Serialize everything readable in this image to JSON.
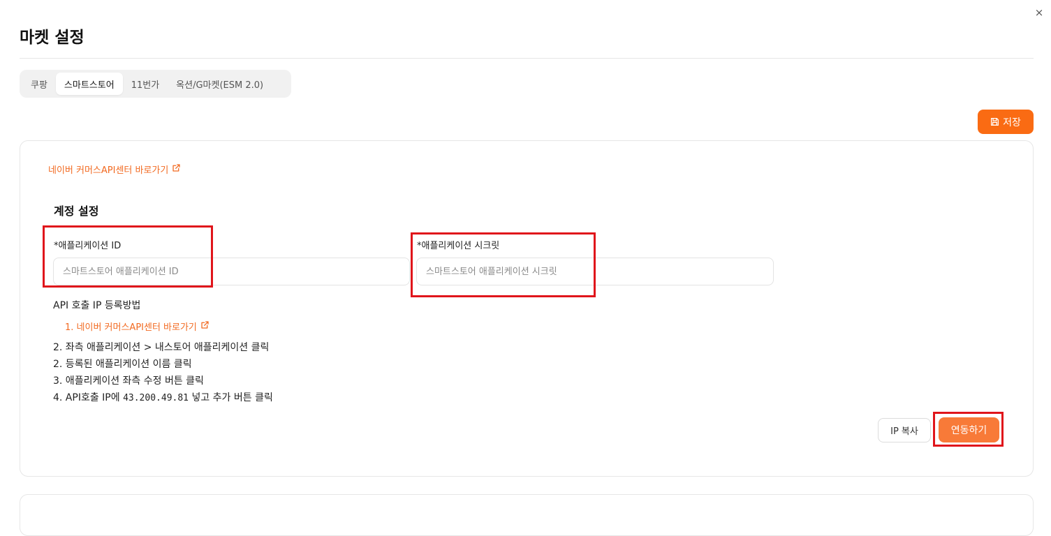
{
  "window": {
    "close_glyph": "×",
    "title": "마켓 설정"
  },
  "tabs": [
    {
      "label": "쿠팡",
      "active": false
    },
    {
      "label": "스마트스토어",
      "active": true
    },
    {
      "label": "11번가",
      "active": false
    },
    {
      "label": "옥션/G마켓(ESM 2.0)",
      "active": false
    }
  ],
  "toolbar": {
    "save_label": "저장",
    "save_icon": "floppy-disk-icon"
  },
  "card": {
    "api_center_link": "네이버 커머스API센터 바로가기",
    "link_icon": "external-link-icon",
    "section_title": "계정 설정",
    "app_id": {
      "label": "*애플리케이션 ID",
      "placeholder": "스마트스토어 애플리케이션 ID",
      "value": ""
    },
    "app_secret": {
      "label": "*애플리케이션 시크릿",
      "placeholder": "스마트스토어 애플리케이션 시크릿",
      "value": ""
    },
    "guide": {
      "title": "API 호출 IP 등록방법",
      "link": "1. 네이버 커머스API센터 바로가기",
      "step1": "2. 좌측 애플리케이션 > 내스토어 애플리케이션 클릭",
      "step2": "2. 등록된 애플리케이션 이름 클릭",
      "step3": "3. 애플리케이션 좌측 수정 버튼 클릭",
      "step4_prefix": "4. API호출 IP에 ",
      "step4_ip": "43.200.49.81",
      "step4_suffix": " 넣고 추가 버튼 클릭"
    },
    "ip_copy_label": "IP 복사",
    "connect_label": "연동하기"
  },
  "colors": {
    "accent": "#fa6b13",
    "connect": "#f87a38",
    "link": "#f26a21",
    "highlight": "#e0151b"
  }
}
